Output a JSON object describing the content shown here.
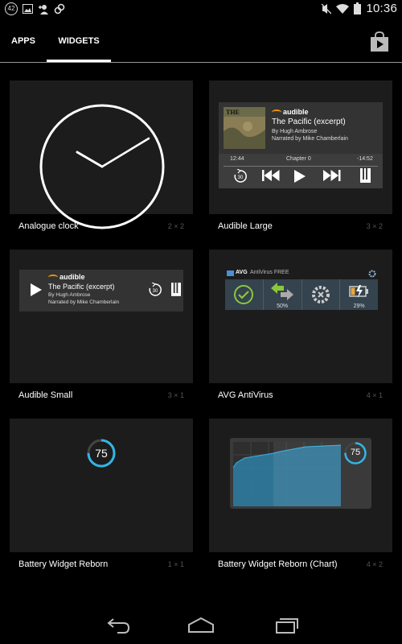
{
  "status_bar": {
    "notification_count": "42",
    "time": "10:36",
    "icons": [
      "notification-count-icon",
      "image-icon",
      "add-contact-icon",
      "sync-icon",
      "mute-icon",
      "wifi-icon",
      "battery-icon"
    ]
  },
  "tabs": [
    {
      "label": "APPS",
      "selected": false
    },
    {
      "label": "WIDGETS",
      "selected": true
    }
  ],
  "store_icon": "store-bag-icon",
  "widgets": [
    {
      "label": "Analogue clock",
      "size": "2 × 2",
      "preview": "analog-clock"
    },
    {
      "label": "Audible Large",
      "size": "3 × 2",
      "preview": {
        "cover_title": "THE PACIFIC",
        "logo": "audible",
        "title": "The Pacific (excerpt)",
        "author": "By Hugh Ambrose",
        "narrator": "Narrated by Mike Chamberlain",
        "elapsed": "12:44",
        "chapter": "Chapter 0",
        "remaining": "-14:52",
        "skip_back": "30"
      }
    },
    {
      "label": "Audible Small",
      "size": "3 × 1",
      "preview": {
        "logo": "audible",
        "title": "The Pacific (excerpt)",
        "author": "By Hugh Ambrose",
        "narrator": "Narrated by Mike Chamberlain",
        "skip_back": "30"
      }
    },
    {
      "label": "AVG AntiVirus",
      "size": "4 × 1",
      "preview": {
        "brand": "AVG",
        "product": "AntiVirus FREE",
        "values": [
          "50%",
          "29%"
        ]
      }
    },
    {
      "label": "Battery Widget Reborn",
      "size": "1 × 1",
      "preview": {
        "level": "75",
        "level_fraction": 0.75
      }
    },
    {
      "label": "Battery Widget Reborn (Chart)",
      "size": "4 × 2",
      "preview": {
        "level": "75",
        "level_fraction": 0.75
      }
    }
  ],
  "colors": {
    "accent_blue": "#33b5e5",
    "audible_orange": "#f39200",
    "avg_green": "#8cc63f"
  },
  "nav_bar": {
    "icons": [
      "back-icon",
      "home-icon",
      "recents-icon"
    ]
  }
}
